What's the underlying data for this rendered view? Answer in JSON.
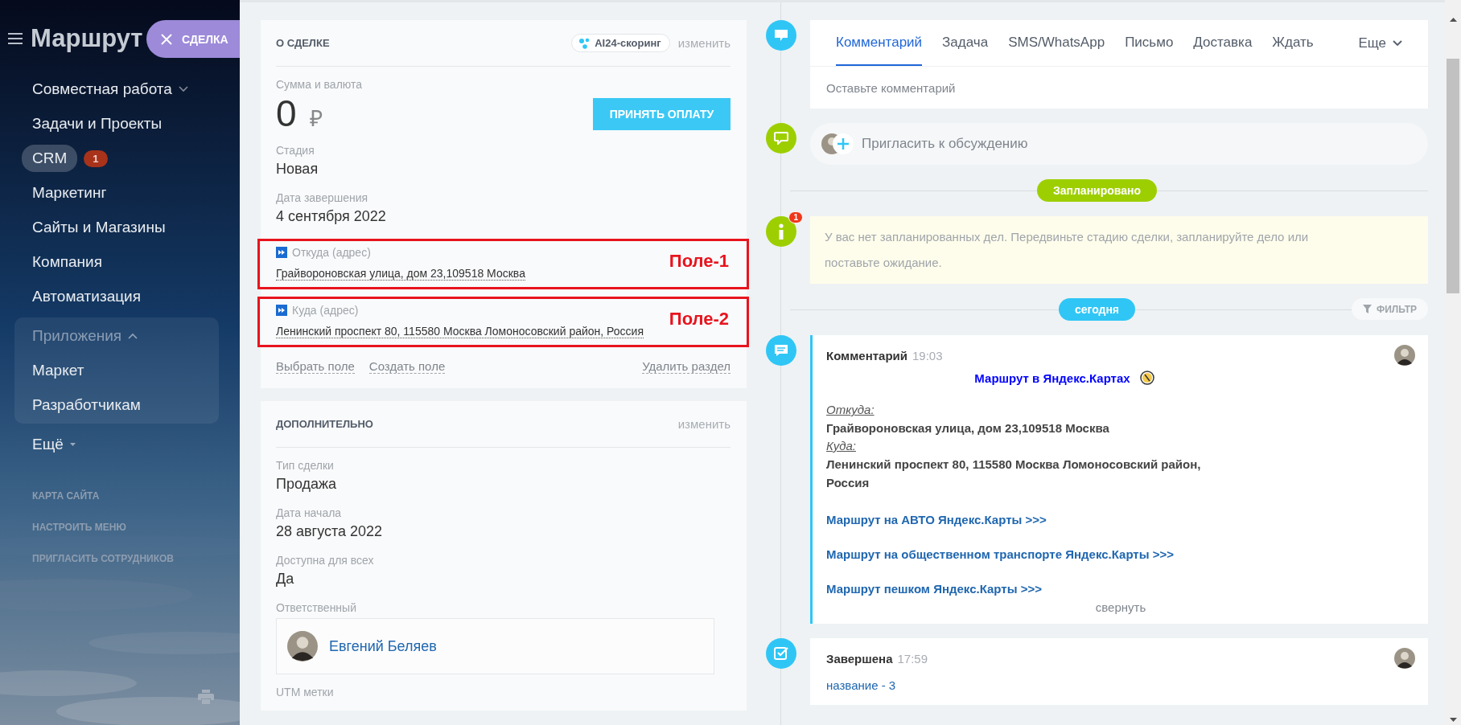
{
  "sidebar": {
    "title": "Маршрут",
    "deal_button": "СДЕЛКА",
    "items": [
      {
        "kind": "group",
        "label": "Совместная работа",
        "selected": false,
        "expanded": false
      },
      {
        "kind": "item",
        "label": "Задачи и Проекты",
        "selected": false
      },
      {
        "kind": "item",
        "label": "CRM",
        "selected": true,
        "badge": "1"
      },
      {
        "kind": "item",
        "label": "Маркетинг",
        "selected": false
      },
      {
        "kind": "item",
        "label": "Сайты и Магазины",
        "selected": false
      },
      {
        "kind": "item",
        "label": "Компания",
        "selected": false
      },
      {
        "kind": "item",
        "label": "Автоматизация",
        "selected": false
      },
      {
        "kind": "group",
        "label": "Приложения",
        "selected": false,
        "expanded": true,
        "children": [
          {
            "label": "Маркет",
            "selected": false
          },
          {
            "label": "Разработчикам",
            "selected": false
          }
        ]
      },
      {
        "kind": "more",
        "label": "Ещё",
        "selected": false
      }
    ],
    "footer_links": [
      "КАРТА САЙТА",
      "НАСТРОИТЬ МЕНЮ",
      "ПРИГЛАСИТЬ СОТРУДНИКОВ"
    ]
  },
  "deal": {
    "title": "О СДЕЛКЕ",
    "scoring": "AI24-скоринг",
    "edit": "изменить",
    "amount_label": "Сумма и валюта",
    "amount": "0",
    "currency": "₽",
    "pay_button": "ПРИНЯТЬ ОПЛАТУ",
    "fields": [
      {
        "kind": "plain",
        "label": "Стадия",
        "value": "Новая"
      },
      {
        "kind": "plain",
        "label": "Дата завершения",
        "value": "4 сентября 2022"
      },
      {
        "kind": "address",
        "label": "Откуда (адрес)",
        "value": "Грайвороновская улица, дом 23,109518 Москва",
        "annotation": "Поле-1"
      },
      {
        "kind": "address",
        "label": "Куда (адрес)",
        "value": "Ленинский проспект 80, 115580 Москва Ломоносовский район, Россия",
        "annotation": "Поле-2"
      }
    ],
    "actions": [
      "Выбрать поле",
      "Создать поле"
    ],
    "delete": "Удалить раздел"
  },
  "extra": {
    "title": "ДОПОЛНИТЕЛЬНО",
    "edit": "изменить",
    "fields": [
      {
        "label": "Тип сделки",
        "value": "Продажа"
      },
      {
        "label": "Дата начала",
        "value": "28 августа 2022"
      },
      {
        "label": "Доступна для всех",
        "value": "Да"
      }
    ],
    "responsible": {
      "label": "Ответственный",
      "name": "Евгений Беляев"
    },
    "next_label": "UTM метки"
  },
  "composer": {
    "tabs": [
      {
        "label": "Комментарий",
        "selected": true
      },
      {
        "label": "Задача",
        "selected": false
      },
      {
        "label": "SMS/WhatsApp",
        "selected": false
      },
      {
        "label": "Письмо",
        "selected": false
      },
      {
        "label": "Доставка",
        "selected": false
      },
      {
        "label": "Ждать",
        "selected": false
      }
    ],
    "more": "Еще",
    "placeholder": "Оставьте комментарий"
  },
  "invite": "Пригласить к обсуждению",
  "timeline": [
    {
      "kind": "divider",
      "label": "Запланировано",
      "color": "#9dcf00"
    },
    {
      "kind": "notice",
      "badge": "1",
      "text": "У вас нет запланированных дел. Передвиньте стадию сделки, запланируйте дело или поставьте ожидание."
    },
    {
      "kind": "divider",
      "label": "сегодня",
      "color": "#2fc6f6",
      "filter": "ФИЛЬТР"
    },
    {
      "kind": "comment",
      "title": "Комментарий",
      "time": "19:03",
      "heading": "Маршрут в Яндекс.Картах",
      "from_label": "Откуда:",
      "from": "Грайвороновская улица, дом 23,109518 Москва",
      "to_label": "Куда:",
      "to": "Ленинский проспект 80, 115580 Москва Ломоносовский район, Россия",
      "links": [
        "Маршрут на АВТО Яндекс.Карты >>>",
        "Маршрут на общественном транспорте Яндекс.Карты >>>",
        "Маршрут пешком Яндекс.Карты >>>"
      ],
      "collapse": "свернуть"
    },
    {
      "kind": "done",
      "title": "Завершена",
      "time": "17:59",
      "link": "название - 3"
    }
  ]
}
